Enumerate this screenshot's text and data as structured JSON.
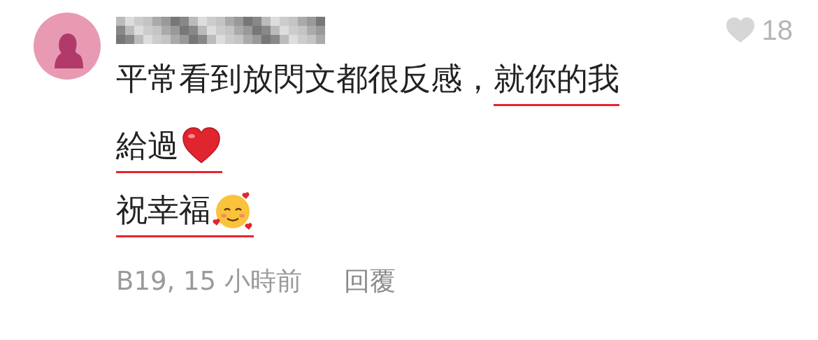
{
  "comment": {
    "likes": {
      "count": "18",
      "liked": false
    },
    "lines": [
      {
        "segments": [
          {
            "kind": "plain",
            "text": "平常看到放閃文都很反感，",
            "underlined": false
          },
          {
            "kind": "plain",
            "text": "就你的我",
            "underlined": true
          }
        ]
      },
      {
        "segments": [
          {
            "kind": "heart",
            "text": "給過",
            "underlined": true
          }
        ]
      },
      {
        "segments": [
          {
            "kind": "smile",
            "text": "祝幸福",
            "underlined": true
          }
        ]
      }
    ],
    "meta": "B19, 15 小時前",
    "reply": "回覆"
  }
}
